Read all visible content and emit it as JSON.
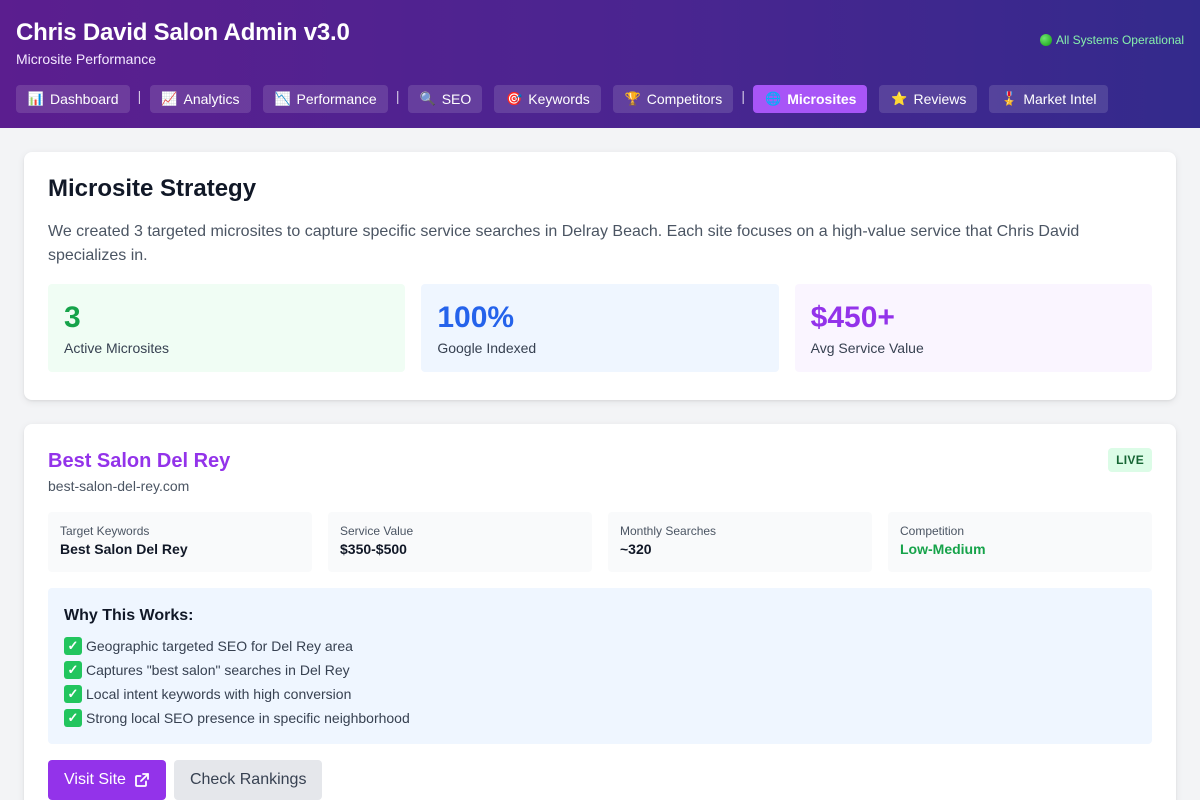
{
  "header": {
    "title": "Chris David Salon Admin v3.0",
    "subtitle": "Microsite Performance",
    "status": "All Systems Operational"
  },
  "nav": [
    {
      "label": "Dashboard",
      "icon": "bar-chart-icon",
      "glyph": "📊",
      "active": false
    },
    {
      "label": "Analytics",
      "icon": "trend-up-icon",
      "glyph": "📈",
      "active": false
    },
    {
      "label": "Performance",
      "icon": "trend-down-icon",
      "glyph": "📉",
      "active": false
    },
    {
      "label": "SEO",
      "icon": "magnifier-icon",
      "glyph": "🔍",
      "active": false
    },
    {
      "label": "Keywords",
      "icon": "target-icon",
      "glyph": "🎯",
      "active": false
    },
    {
      "label": "Competitors",
      "icon": "trophy-icon",
      "glyph": "🏆",
      "active": false
    },
    {
      "label": "Microsites",
      "icon": "globe-icon",
      "glyph": "🌐",
      "active": true
    },
    {
      "label": "Reviews",
      "icon": "star-icon",
      "glyph": "⭐",
      "active": false
    },
    {
      "label": "Market Intel",
      "icon": "medal-icon",
      "glyph": "🎖️",
      "active": false
    }
  ],
  "strategy": {
    "title": "Microsite Strategy",
    "description": "We created 3 targeted microsites to capture specific service searches in Delray Beach. Each site focuses on a high-value service that Chris David specializes in.",
    "stats": [
      {
        "value": "3",
        "label": "Active Microsites"
      },
      {
        "value": "100%",
        "label": "Google Indexed"
      },
      {
        "value": "$450+",
        "label": "Avg Service Value"
      }
    ]
  },
  "site": {
    "title": "Best Salon Del Rey",
    "domain": "best-salon-del-rey.com",
    "badge": "LIVE",
    "metrics": [
      {
        "label": "Target Keywords",
        "value": "Best Salon Del Rey"
      },
      {
        "label": "Service Value",
        "value": "$350-$500"
      },
      {
        "label": "Monthly Searches",
        "value": "~320"
      },
      {
        "label": "Competition",
        "value": "Low-Medium"
      }
    ],
    "why_title": "Why This Works:",
    "why_items": [
      "Geographic targeted SEO for Del Rey area",
      "Captures \"best salon\" searches in Del Rey",
      "Local intent keywords with high conversion",
      "Strong local SEO presence in specific neighborhood"
    ],
    "visit_label": "Visit Site",
    "rankings_label": "Check Rankings"
  },
  "colors": {
    "accent": "#9333ea",
    "active_tab": "#a855f7",
    "live_badge": "#dcfce7",
    "status": "#86efac"
  }
}
